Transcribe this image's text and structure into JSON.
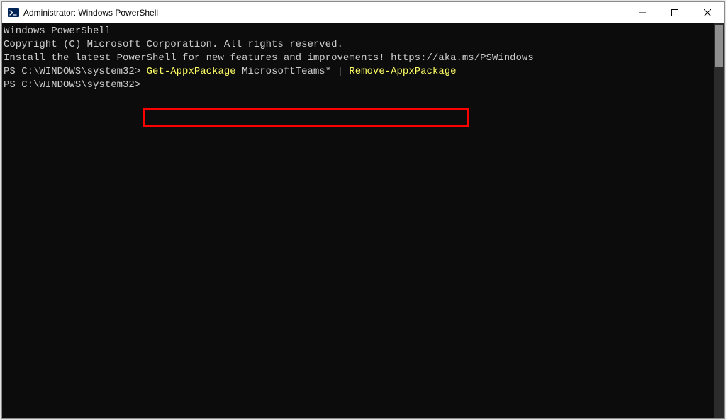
{
  "window": {
    "title": "Administrator: Windows PowerShell"
  },
  "terminal": {
    "line1": "Windows PowerShell",
    "line2": "Copyright (C) Microsoft Corporation. All rights reserved.",
    "blank1": "",
    "line3": "Install the latest PowerShell for new features and improvements! https://aka.ms/PSWindows",
    "blank2": "",
    "prompt1_prefix": "PS C:\\WINDOWS\\system32> ",
    "cmd_part1": "Get-AppxPackage ",
    "cmd_arg": "MicrosoftTeams*",
    "cmd_pipe": " | ",
    "cmd_part2": "Remove-AppxPackage",
    "prompt2": "PS C:\\WINDOWS\\system32>"
  }
}
